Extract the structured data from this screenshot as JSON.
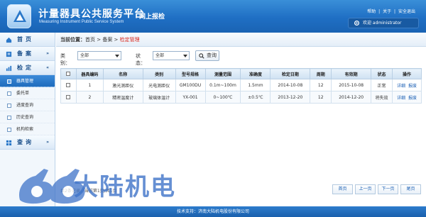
{
  "header": {
    "title": "计量器具公共服务平台",
    "subtitle": "Measuring Instrument Public Service System",
    "badge": "网上报检",
    "links": [
      "帮助",
      "|",
      "关于",
      "|",
      "安全退出"
    ],
    "user_label": "欢迎 administrator"
  },
  "sidebar": {
    "home": {
      "label": "首页"
    },
    "record": {
      "label": "备案",
      "arrow": "»"
    },
    "inspect": {
      "label": "检定",
      "arrow": "«"
    },
    "items": [
      {
        "label": "器具管理",
        "active": true
      },
      {
        "label": "委托单"
      },
      {
        "label": "进度查询"
      },
      {
        "label": "历史查询"
      },
      {
        "label": "机构检索"
      }
    ],
    "query": {
      "label": "查询",
      "arrow": "»"
    }
  },
  "breadcrumb": {
    "prefix": "当前位置：",
    "path1": "首页",
    "sep1": " > ",
    "path2": "备案",
    "sep2": " > ",
    "current": "检定管理"
  },
  "filters": {
    "category_label": "类别：",
    "category_value": "全部",
    "status_label": "状态：",
    "status_value": "全部",
    "query_button": "查询"
  },
  "table": {
    "headers": [
      "",
      "器具编码",
      "名称",
      "类别",
      "型号规格",
      "测量范围",
      "准确度",
      "检定日期",
      "周期",
      "有效期",
      "状态",
      "操作"
    ],
    "rows": [
      {
        "no": "1",
        "name": "激光测距仪",
        "category": "光电测距仪",
        "model": "GM100DU",
        "range": "0.1m~100m",
        "accuracy": "1.5mm",
        "date": "2014-10-08",
        "cycle": "12",
        "expiry": "2015-10-08",
        "status": "正常",
        "op1": "详细",
        "op2": "报废"
      },
      {
        "no": "2",
        "name": "精密温度计",
        "category": "玻璃体温计",
        "model": "YX-001",
        "range": "0~100℃",
        "accuracy": "±0.5℃",
        "date": "2013-12-20",
        "cycle": "12",
        "expiry": "2014-12-20",
        "status": "将失效",
        "op1": "详细",
        "op2": "报废"
      }
    ]
  },
  "pagination": {
    "info": "共2条记录，当前第1页/共1页",
    "first": "首页",
    "prev": "上一页",
    "next": "下一页",
    "last": "尾页"
  },
  "footer": {
    "text": "技术支持：济南大陆机电股份有限公司"
  },
  "watermark": {
    "text": "大陆机电"
  },
  "colors": {
    "primary": "#1f6fc4",
    "active": "#2a7bd0",
    "danger": "#d9261c",
    "link": "#1a5fb4"
  }
}
